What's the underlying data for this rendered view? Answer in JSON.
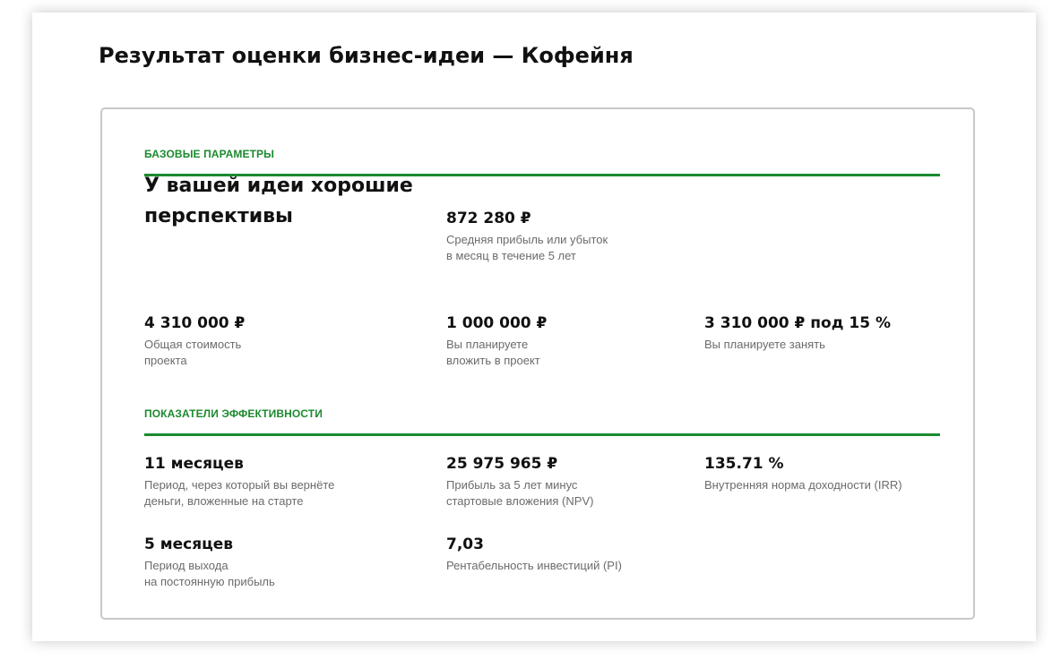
{
  "page": {
    "title": "Результат оценки бизнес-идеи — Кофейня"
  },
  "colors": {
    "accent": "#1b8a2e",
    "border": "#c8c8c8",
    "muted_text": "#6b6b6b"
  },
  "base_section": {
    "heading": "БАЗОВЫЕ ПАРАМЕТРЫ",
    "verdict": "У вашей идеи хорошие перспективы",
    "avg_profit": {
      "value": "872 280 ₽",
      "label": "Средняя прибыль или убыток\nв месяц в течение 5 лет"
    },
    "total_cost": {
      "value": "4 310 000 ₽",
      "label": "Общая стоимость\nпроекта"
    },
    "own_investment": {
      "value": "1 000 000 ₽",
      "label": "Вы планируете\nвложить в проект"
    },
    "loan": {
      "value": "3 310 000 ₽ под 15 %",
      "label": "Вы планируете занять"
    }
  },
  "efficiency_section": {
    "heading": "ПОКАЗАТЕЛИ ЭФФЕКТИВНОСТИ",
    "payback": {
      "value": "11 месяцев",
      "label": "Период, через который вы вернёте\nденьги, вложенные на старте"
    },
    "npv": {
      "value": "25 975 965 ₽",
      "label": "Прибыль за 5 лет минус\nстартовые вложения (NPV)"
    },
    "irr": {
      "value": "135.71 %",
      "label": "Внутренняя норма доходности (IRR)"
    },
    "breakeven": {
      "value": "5 месяцев",
      "label": "Период выхода\nна постоянную прибыль"
    },
    "pi": {
      "value": "7,03",
      "label": "Рентабельность инвестиций (PI)"
    }
  }
}
